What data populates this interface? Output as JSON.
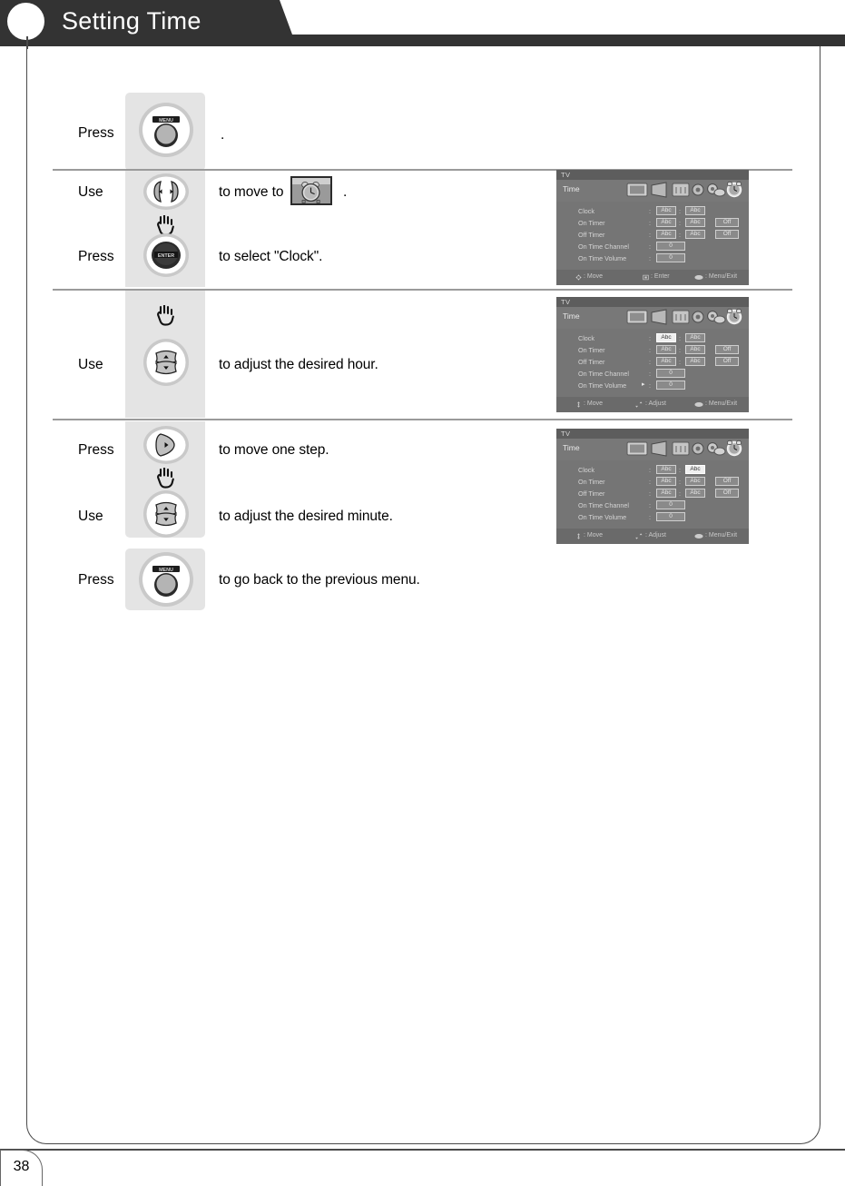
{
  "header": {
    "title": "Setting Time",
    "circle_icon": "white-circle-marker"
  },
  "page": {
    "number": "38"
  },
  "sections": [
    {
      "id": "section-1",
      "steps": [
        {
          "action": "Press",
          "button": "menu-button",
          "button_label": "MENU",
          "description": "."
        }
      ]
    },
    {
      "id": "section-2",
      "steps": [
        {
          "action": "Use",
          "button": "left-right-arrow-button",
          "button_label": "◀ ▶",
          "description_before": "to move to",
          "inline_icon": "alarm-clock-icon",
          "description_after": "."
        },
        {
          "action": "Press",
          "button": "enter-button",
          "button_label": "ENTER",
          "description": "to select \"Clock\"."
        }
      ],
      "osd": "osd-1"
    },
    {
      "id": "section-3",
      "steps": [
        {
          "action": "Use",
          "button": "up-down-arrow-button",
          "button_label": "▲ ▼",
          "description": "to adjust the desired hour."
        }
      ],
      "osd": "osd-2"
    },
    {
      "id": "section-4",
      "steps": [
        {
          "action": "Press",
          "button": "right-arrow-button",
          "button_label": "▶",
          "description": "to move one step."
        },
        {
          "action": "Use",
          "button": "up-down-arrow-button",
          "button_label": "▲ ▼",
          "description": "to adjust the desired minute."
        },
        {
          "action": "Press",
          "button": "menu-button",
          "button_label": "MENU",
          "description": "to go back to the previous menu."
        }
      ],
      "osd": "osd-3"
    }
  ],
  "osd_menus": {
    "osd-1": {
      "system_label": "TV",
      "menu_title": "Time",
      "rows": [
        {
          "name": "Clock",
          "v1": "Abc",
          "v2": "Abc",
          "v3": "",
          "hl": "none"
        },
        {
          "name": "On Timer",
          "v1": "Abc",
          "v2": "Abc",
          "v3": "Off",
          "hl": "none"
        },
        {
          "name": "Off Timer",
          "v1": "Abc",
          "v2": "Abc",
          "v3": "Off",
          "hl": "none"
        },
        {
          "name": "On Time Channel",
          "v1": "0",
          "v2": "",
          "v3": "",
          "hl": "none"
        },
        {
          "name": "On Time Volume",
          "v1": "0",
          "v2": "",
          "v3": "",
          "hl": "none"
        }
      ],
      "hints": [
        {
          "icon": "dpad-icon",
          "text": ": Move"
        },
        {
          "icon": "enter-key-icon",
          "text": ": Enter"
        },
        {
          "icon": "menu-key-icon",
          "text": ": Menu/Exit"
        }
      ],
      "cursor_row": -1
    },
    "osd-2": {
      "system_label": "TV",
      "menu_title": "Time",
      "rows": [
        {
          "name": "Clock",
          "v1": "Abc",
          "v2": "Abc",
          "v3": "",
          "hl": "v1"
        },
        {
          "name": "On Timer",
          "v1": "Abc",
          "v2": "Abc",
          "v3": "Off",
          "hl": "none"
        },
        {
          "name": "Off Timer",
          "v1": "Abc",
          "v2": "Abc",
          "v3": "Off",
          "hl": "none"
        },
        {
          "name": "On Time Channel",
          "v1": "0",
          "v2": "",
          "v3": "",
          "hl": "none"
        },
        {
          "name": "On Time Volume",
          "v1": "0",
          "v2": "",
          "v3": "",
          "hl": "none"
        }
      ],
      "hints": [
        {
          "icon": "updown-icon",
          "text": ": Move"
        },
        {
          "icon": "updown-icon",
          "text": ": Adjust"
        },
        {
          "icon": "menu-key-icon",
          "text": ": Menu/Exit"
        }
      ],
      "cursor_row": 4
    },
    "osd-3": {
      "system_label": "TV",
      "menu_title": "Time",
      "rows": [
        {
          "name": "Clock",
          "v1": "Abc",
          "v2": "Abc",
          "v3": "",
          "hl": "v2"
        },
        {
          "name": "On Timer",
          "v1": "Abc",
          "v2": "Abc",
          "v3": "Off",
          "hl": "none"
        },
        {
          "name": "Off Timer",
          "v1": "Abc",
          "v2": "Abc",
          "v3": "Off",
          "hl": "none"
        },
        {
          "name": "On Time Channel",
          "v1": "0",
          "v2": "",
          "v3": "",
          "hl": "none"
        },
        {
          "name": "On Time Volume",
          "v1": "0",
          "v2": "",
          "v3": "",
          "hl": "none"
        }
      ],
      "hints": [
        {
          "icon": "updown-icon",
          "text": ": Move"
        },
        {
          "icon": "updown-icon",
          "text": ": Adjust"
        },
        {
          "icon": "menu-key-icon",
          "text": ": Menu/Exit"
        }
      ],
      "cursor_row": -1
    }
  },
  "colors": {
    "header_dark": "#333333",
    "panel_gray": "#e4e4e4",
    "rule_gray": "#9a9a9a",
    "osd_bg": "#757575",
    "osd_highlight": "#f0f0f0"
  }
}
